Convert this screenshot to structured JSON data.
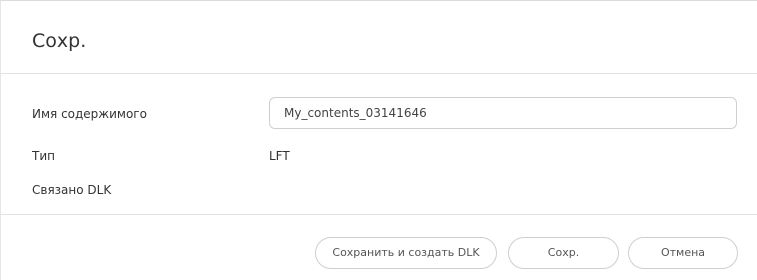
{
  "dialog": {
    "title": "Сохр."
  },
  "fields": {
    "content_name": {
      "label": "Имя содержимого",
      "value": "My_contents_03141646"
    },
    "type": {
      "label": "Тип",
      "value": "LFT"
    },
    "linked_dlk": {
      "label": "Связано DLK",
      "value": ""
    }
  },
  "buttons": {
    "save_and_create_dlk": "Сохранить и создать DLK",
    "save": "Сохр.",
    "cancel": "Отмена"
  }
}
